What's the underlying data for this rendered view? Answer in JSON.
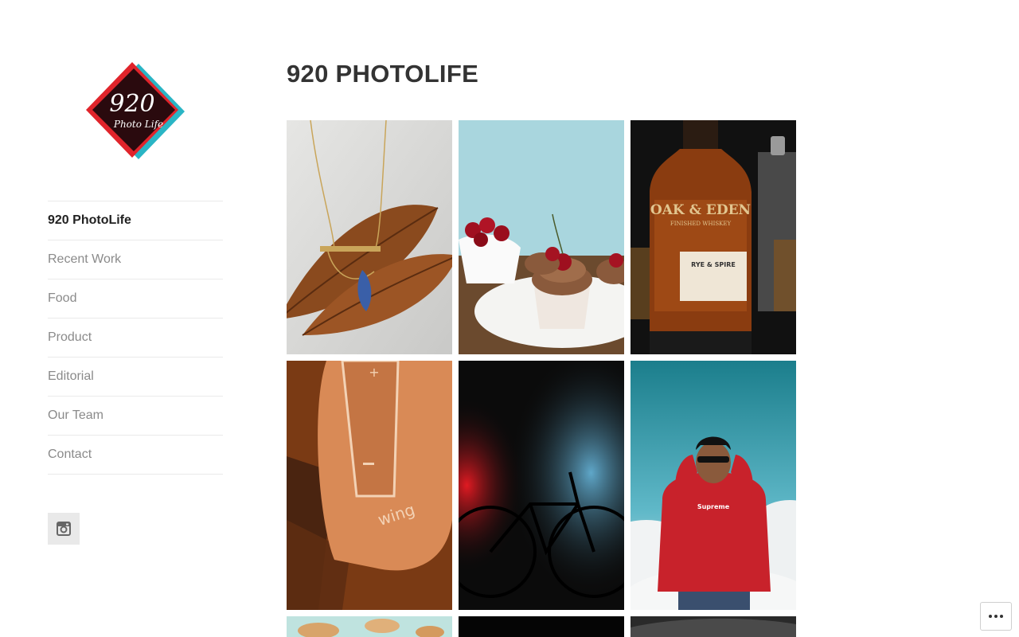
{
  "site": {
    "title": "920 PHOTOLIFE",
    "logo_text": "920",
    "logo_subtext": "Photo Life"
  },
  "nav": {
    "items": [
      {
        "label": "920 PhotoLife",
        "active": true
      },
      {
        "label": "Recent Work",
        "active": false
      },
      {
        "label": "Food",
        "active": false
      },
      {
        "label": "Product",
        "active": false
      },
      {
        "label": "Editorial",
        "active": false
      },
      {
        "label": "Our Team",
        "active": false
      },
      {
        "label": "Contact",
        "active": false
      }
    ]
  },
  "social": {
    "icon": "instagram-icon"
  },
  "gallery": {
    "photos": [
      {
        "subject": "necklace-on-leaves"
      },
      {
        "subject": "cherry-cupcakes"
      },
      {
        "subject": "whiskey-bottle"
      },
      {
        "subject": "wing-speaker"
      },
      {
        "subject": "bicycle-silhouette"
      },
      {
        "subject": "man-red-hoodie"
      },
      {
        "subject": "cookies"
      },
      {
        "subject": "dark-photo"
      },
      {
        "subject": "dark-object"
      }
    ],
    "bottle_text": {
      "brand": "OAK & EDEN",
      "sub": "FINISHED WHISKEY",
      "label": "RYE & SPIRE"
    },
    "speaker_text": "wing",
    "hoodie_text": "Supreme"
  },
  "footer": {
    "more_icon": "more-horizontal-icon"
  },
  "colors": {
    "accent": "#333333",
    "nav_muted": "#8a8a8a",
    "divider": "#eaeaea"
  }
}
